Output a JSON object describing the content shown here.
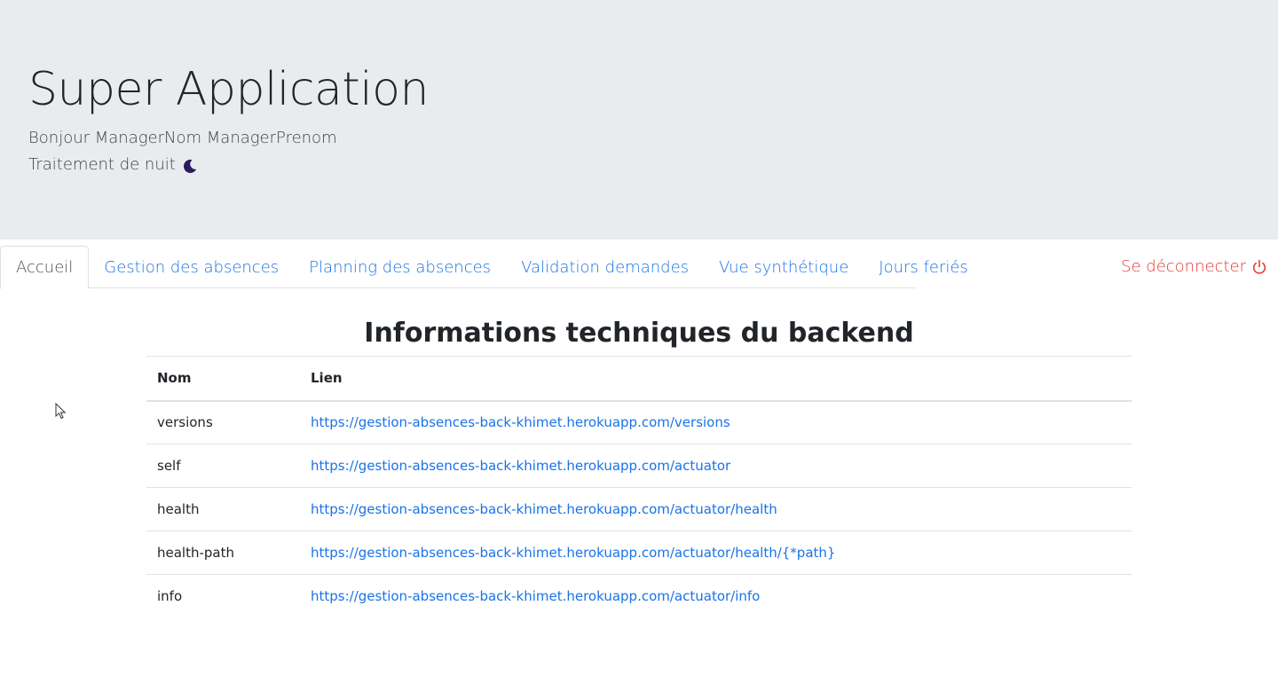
{
  "header": {
    "title": "Super Application",
    "greeting": "Bonjour ManagerNom ManagerPrenom",
    "night_label": "Traitement de nuit",
    "night_icon": "moon-icon"
  },
  "nav": {
    "tabs": [
      {
        "label": "Accueil",
        "active": true
      },
      {
        "label": "Gestion des absences",
        "active": false
      },
      {
        "label": "Planning des absences",
        "active": false
      },
      {
        "label": "Validation demandes",
        "active": false
      },
      {
        "label": "Vue synthétique",
        "active": false
      },
      {
        "label": "Jours feriés",
        "active": false
      }
    ],
    "logout_label": "Se déconnecter",
    "logout_icon": "power-icon"
  },
  "main": {
    "title": "Informations techniques du backend",
    "table": {
      "headers": [
        "Nom",
        "Lien"
      ],
      "rows": [
        {
          "name": "versions",
          "link": "https://gestion-absences-back-khimet.herokuapp.com/versions"
        },
        {
          "name": "self",
          "link": "https://gestion-absences-back-khimet.herokuapp.com/actuator"
        },
        {
          "name": "health",
          "link": "https://gestion-absences-back-khimet.herokuapp.com/actuator/health"
        },
        {
          "name": "health-path",
          "link": "https://gestion-absences-back-khimet.herokuapp.com/actuator/health/{*path}"
        },
        {
          "name": "info",
          "link": "https://gestion-absences-back-khimet.herokuapp.com/actuator/info"
        }
      ]
    }
  },
  "colors": {
    "accent": "#1a73e8",
    "danger": "#e53935",
    "jumbotron": "#e9ecef",
    "moon": "#2b1a5e"
  }
}
